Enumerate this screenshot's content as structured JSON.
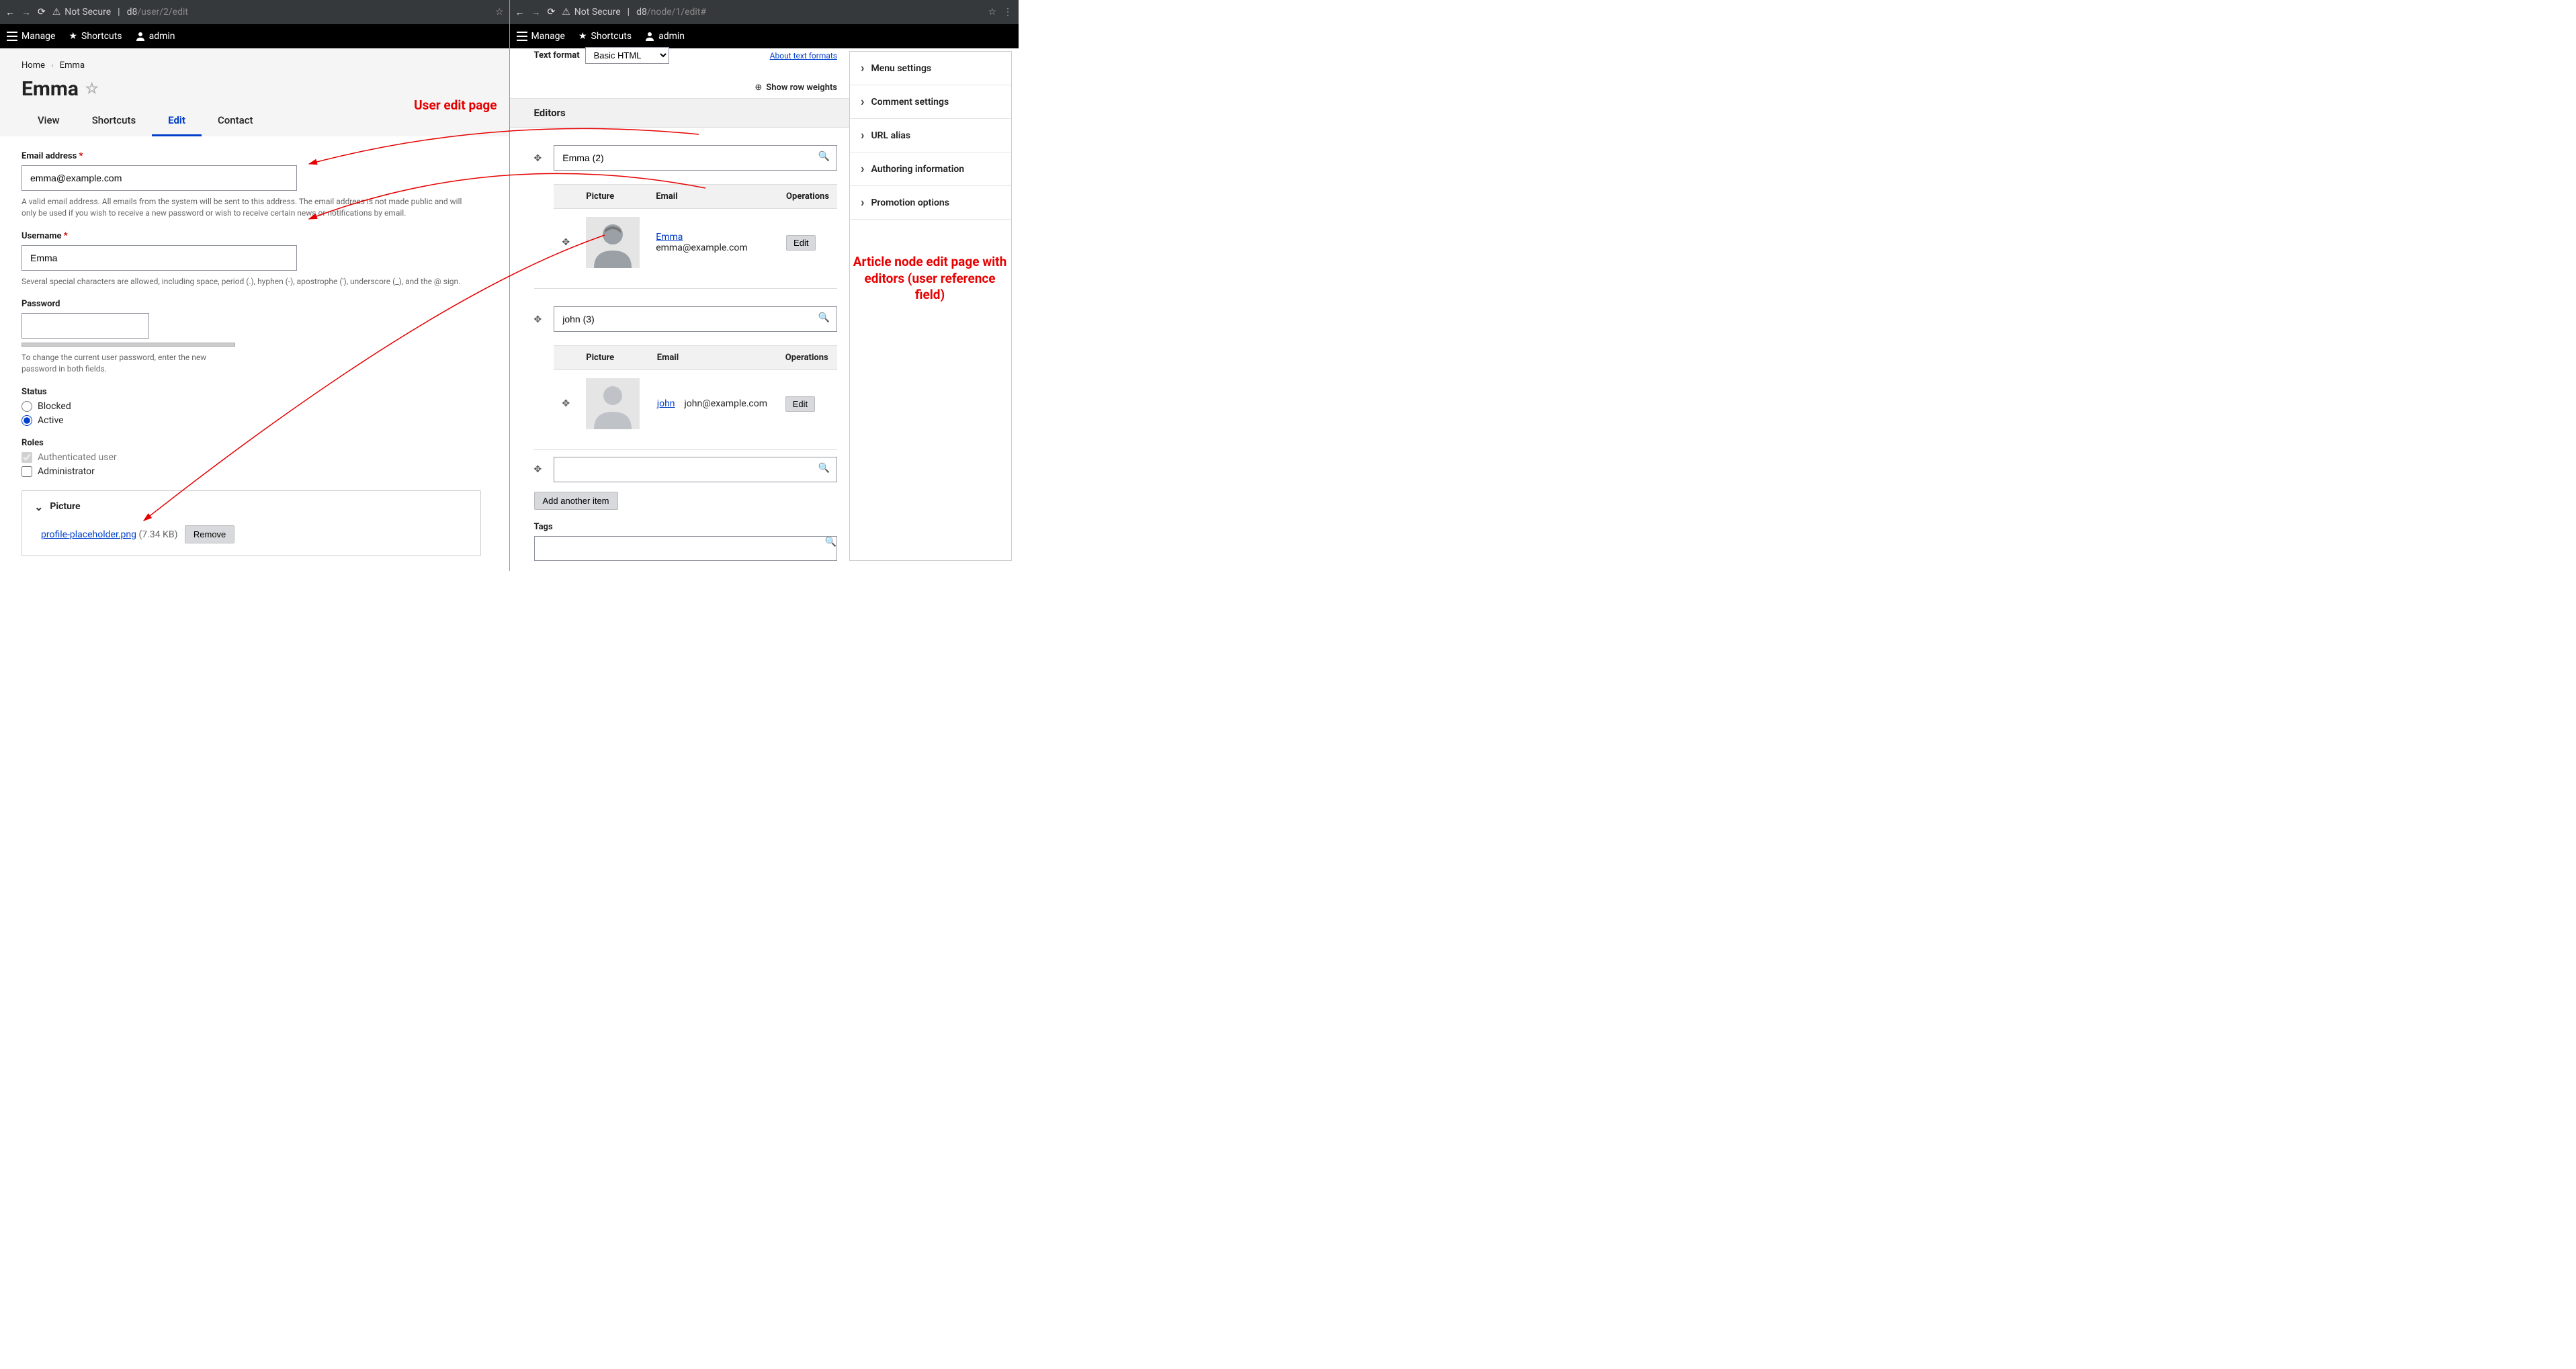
{
  "left": {
    "browser": {
      "not_secure": "Not Secure",
      "host": "d8",
      "path": "/user/2/edit"
    },
    "admin": {
      "manage": "Manage",
      "shortcuts": "Shortcuts",
      "user": "admin"
    },
    "breadcrumb": {
      "home": "Home",
      "current": "Emma"
    },
    "page_title": "Emma",
    "tabs": {
      "view": "View",
      "shortcuts": "Shortcuts",
      "edit": "Edit",
      "contact": "Contact"
    },
    "email": {
      "label": "Email address",
      "value": "emma@example.com",
      "help": "A valid email address. All emails from the system will be sent to this address. The email address is not made public and will only be used if you wish to receive a new password or wish to receive certain news or notifications by email."
    },
    "username": {
      "label": "Username",
      "value": "Emma",
      "help": "Several special characters are allowed, including space, period (.), hyphen (-), apostrophe ('), underscore (_), and the @ sign."
    },
    "password": {
      "label": "Password",
      "help": "To change the current user password, enter the new password in both fields."
    },
    "status": {
      "label": "Status",
      "blocked": "Blocked",
      "active": "Active"
    },
    "roles": {
      "label": "Roles",
      "auth": "Authenticated user",
      "admin": "Administrator"
    },
    "picture": {
      "label": "Picture",
      "file": "profile-placeholder.png",
      "size": "(7.34 KB)",
      "remove": "Remove"
    },
    "annotation": "User edit page"
  },
  "right": {
    "browser": {
      "not_secure": "Not Secure",
      "host": "d8",
      "path": "/node/1/edit#"
    },
    "admin": {
      "manage": "Manage",
      "shortcuts": "Shortcuts",
      "user": "admin"
    },
    "text_format": {
      "label": "Text format",
      "value": "Basic HTML",
      "about": "About text formats"
    },
    "show_row_weights": "Show row weights",
    "editors_heading": "Editors",
    "col": {
      "picture": "Picture",
      "email": "Email",
      "ops": "Operations"
    },
    "items": [
      {
        "ac": "Emma (2)",
        "name": "Emma",
        "email": "emma@example.com",
        "edit": "Edit"
      },
      {
        "ac": "john (3)",
        "name": "john",
        "email": "john@example.com",
        "edit": "Edit"
      }
    ],
    "add_another": "Add another item",
    "tags_label": "Tags",
    "sidebar": {
      "menu": "Menu settings",
      "comment": "Comment settings",
      "url": "URL alias",
      "auth": "Authoring information",
      "promo": "Promotion options"
    },
    "annotation": "Article node edit page with editors (user reference field)"
  }
}
